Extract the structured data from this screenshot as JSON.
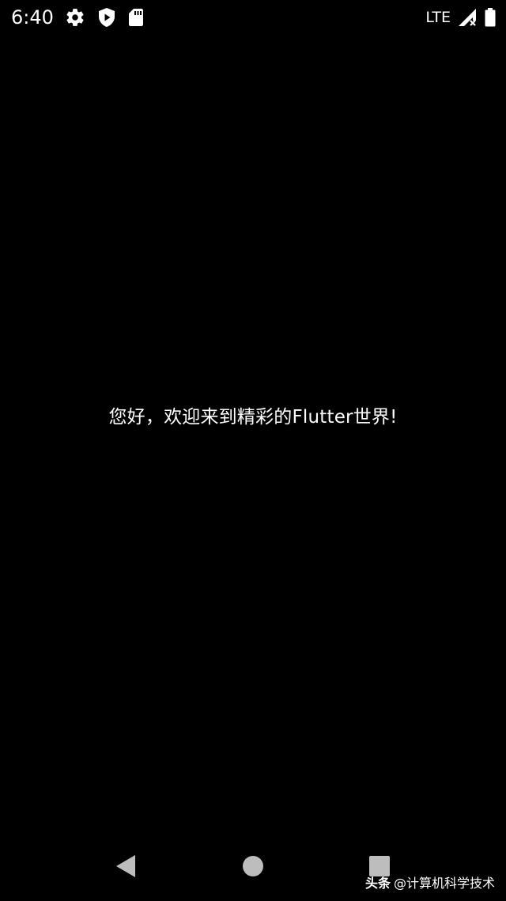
{
  "status_bar": {
    "time": "6:40",
    "network": "LTE",
    "left_icons": [
      "gear-icon",
      "shield-play-icon",
      "sd-card-icon"
    ],
    "right_icons": [
      "signal-no-data-icon",
      "battery-icon"
    ]
  },
  "main": {
    "message": "您好，欢迎来到精彩的Flutter世界!"
  },
  "nav_bar": {
    "buttons": [
      "back-icon",
      "home-icon",
      "recents-icon"
    ]
  },
  "watermark": {
    "brand": "头条",
    "account": "@计算机科学技术"
  },
  "colors": {
    "background": "#000000",
    "foreground": "#ffffff",
    "nav_icon": "#bdbdbd"
  }
}
